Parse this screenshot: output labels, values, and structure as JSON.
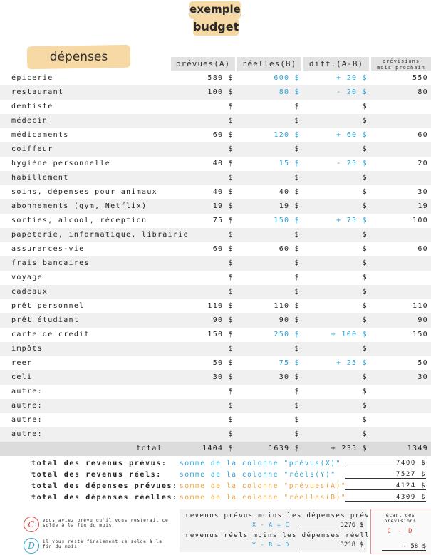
{
  "title": {
    "line1": "exemple",
    "line2": "budget"
  },
  "section_label": "dépenses",
  "headers": {
    "prevues": "prévues(A)",
    "reelles": "réelles(B)",
    "diff": "diff.(A-B)",
    "prev_mois_line1": "prévisions",
    "prev_mois_line2": "mois prochain"
  },
  "rows": [
    {
      "label": "épicerie",
      "a": "580 $",
      "b": "600 $",
      "d": "+ 20 $",
      "p": "550"
    },
    {
      "label": "restaurant",
      "a": "100 $",
      "b": "80 $",
      "d": "- 20 $",
      "p": "80"
    },
    {
      "label": "dentiste",
      "a": "$",
      "b": "$",
      "d": "$",
      "p": ""
    },
    {
      "label": "médecin",
      "a": "$",
      "b": "$",
      "d": "$",
      "p": ""
    },
    {
      "label": "médicaments",
      "a": "60 $",
      "b": "120 $",
      "d": "+ 60 $",
      "p": "60"
    },
    {
      "label": "coiffeur",
      "a": "$",
      "b": "$",
      "d": "$",
      "p": ""
    },
    {
      "label": "hygiène personnelle",
      "a": "40 $",
      "b": "15 $",
      "d": "- 25 $",
      "p": "20"
    },
    {
      "label": "habillement",
      "a": "$",
      "b": "$",
      "d": "$",
      "p": ""
    },
    {
      "label": "soins, dépenses pour animaux",
      "a": "40 $",
      "b": "40 $",
      "d": "$",
      "p": "30"
    },
    {
      "label": "abonnements (gym, Netflix)",
      "a": "19 $",
      "b": "19 $",
      "d": "$",
      "p": "19"
    },
    {
      "label": "sorties, alcool, réception",
      "a": "75 $",
      "b": "150 $",
      "d": "+ 75 $",
      "p": "100"
    },
    {
      "label": "papeterie, informatique, librairie",
      "a": "$",
      "b": "$",
      "d": "$",
      "p": ""
    },
    {
      "label": "assurances-vie",
      "a": "60 $",
      "b": "60 $",
      "d": "$",
      "p": "60"
    },
    {
      "label": "frais bancaires",
      "a": "$",
      "b": "$",
      "d": "$",
      "p": ""
    },
    {
      "label": "voyage",
      "a": "$",
      "b": "$",
      "d": "$",
      "p": ""
    },
    {
      "label": "cadeaux",
      "a": "$",
      "b": "$",
      "d": "$",
      "p": ""
    },
    {
      "label": "prêt personnel",
      "a": "110 $",
      "b": "110 $",
      "d": "$",
      "p": "110"
    },
    {
      "label": "prêt étudiant",
      "a": "90 $",
      "b": "90 $",
      "d": "$",
      "p": "90"
    },
    {
      "label": "carte de crédit",
      "a": "150 $",
      "b": "250 $",
      "d": "+ 100 $",
      "p": "150"
    },
    {
      "label": "impôts",
      "a": "$",
      "b": "$",
      "d": "$",
      "p": ""
    },
    {
      "label": "reer",
      "a": "50 $",
      "b": "75 $",
      "d": "+ 25 $",
      "p": "50"
    },
    {
      "label": "celi",
      "a": "30 $",
      "b": "30 $",
      "d": "$",
      "p": "30"
    },
    {
      "label": "autre:",
      "a": "$",
      "b": "$",
      "d": "$",
      "p": ""
    },
    {
      "label": "autre:",
      "a": "$",
      "b": "$",
      "d": "$",
      "p": ""
    },
    {
      "label": "autre:",
      "a": "$",
      "b": "$",
      "d": "$",
      "p": ""
    },
    {
      "label": "autre:",
      "a": "$",
      "b": "$",
      "d": "$",
      "p": ""
    }
  ],
  "total": {
    "label": "total",
    "a": "1404 $",
    "b": "1639 $",
    "d": "+ 235 $",
    "p": "1349"
  },
  "summary": [
    {
      "label": "total des revenus prévus:",
      "method": "somme de la colonne \"prévus(X)\"",
      "value": "7400 $"
    },
    {
      "label": "total des revenus réels:",
      "method": "somme de la colonne \"réels(Y)\"",
      "value": "7527 $"
    },
    {
      "label": "total des dépenses prévues:",
      "method": "somme de la colonne \"prévues(A)\"",
      "value": "4124 $"
    },
    {
      "label": "total des dépenses réelles:",
      "method": "somme de la colonne \"réelles(B)\"",
      "value": "4309 $"
    }
  ],
  "notes": {
    "c_letter": "C",
    "c_text": "vous aviez prévu qu'il vous resterait ce solde à la fin du mois",
    "d_letter": "D",
    "d_text": "il vous reste finalement ce solde à la fin du mois"
  },
  "middle": {
    "line1": "revenus prévus moins les dépenses prévues",
    "formula1": "X - A = C",
    "value1": "3276 $",
    "line2": "revenus réels moins les dépenses réelles",
    "formula2": "Y - B = D",
    "value2": "3218 $"
  },
  "ecart": {
    "title_line1": "écart des",
    "title_line2": "prévisions",
    "formula": "C - D",
    "value": "- 58 $"
  },
  "colors": {
    "highlight": "#f7d9a6",
    "blue": "#2ba3d8",
    "orange": "#f0a53a",
    "red": "#e0483f"
  }
}
